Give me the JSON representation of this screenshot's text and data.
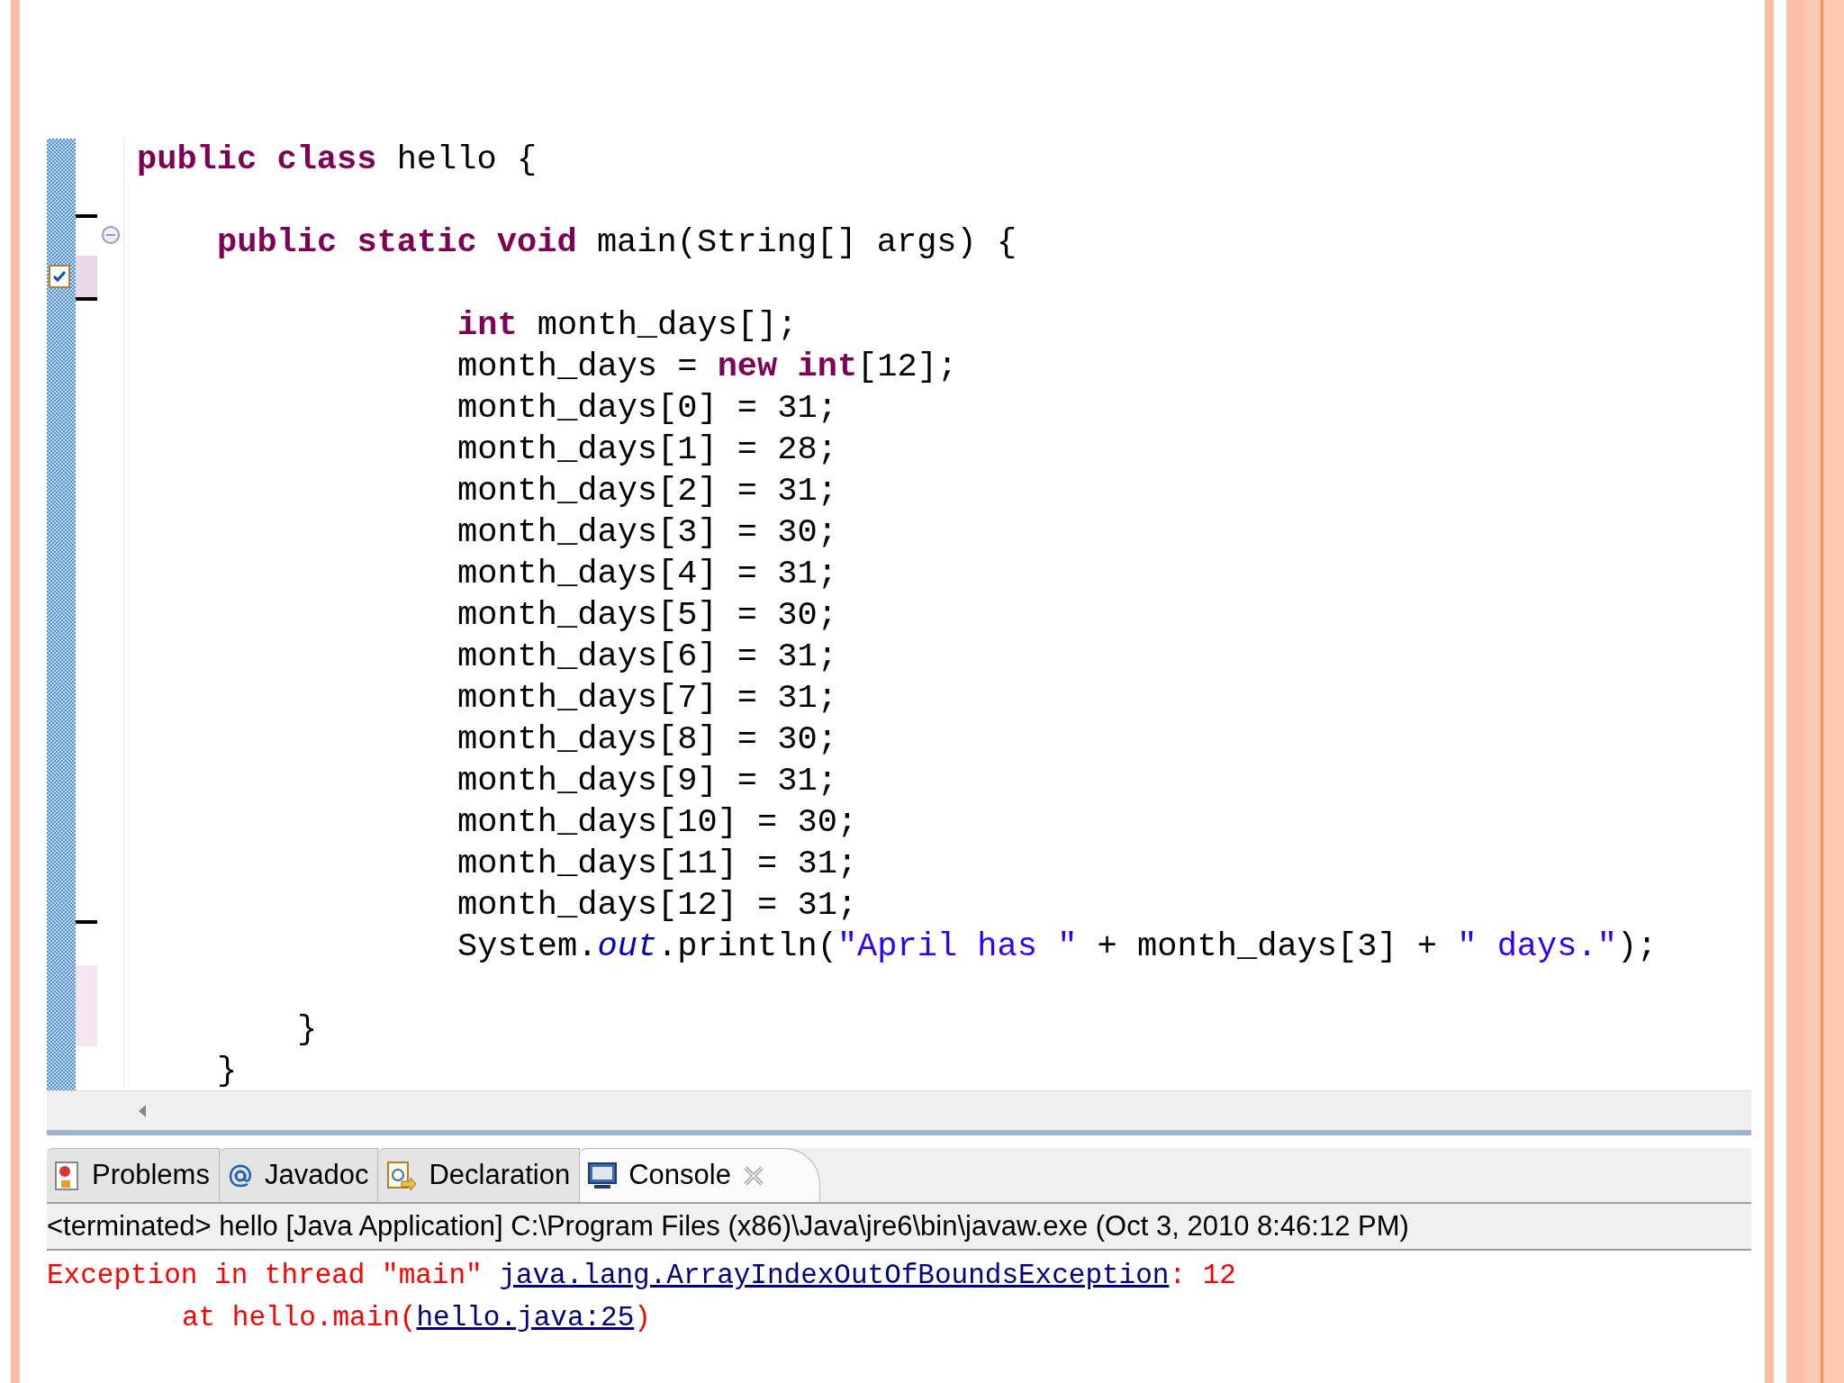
{
  "editor": {
    "lines": [
      {
        "kind": "top",
        "tokens": [
          {
            "kind": "keyword",
            "text": "public class "
          },
          {
            "kind": "plain",
            "text": "hello {"
          }
        ]
      },
      {
        "kind": "blank"
      },
      {
        "kind": "method",
        "tokens": [
          {
            "kind": "keyword",
            "text": "public static void "
          },
          {
            "kind": "plain",
            "text": "main(String[] args) {"
          }
        ]
      },
      {
        "kind": "blank"
      },
      {
        "kind": "body",
        "tokens": [
          {
            "kind": "keyword",
            "text": "int "
          },
          {
            "kind": "plain",
            "text": "month_days[];"
          }
        ]
      },
      {
        "kind": "body",
        "tokens": [
          {
            "kind": "plain",
            "text": "month_days = "
          },
          {
            "kind": "keyword",
            "text": "new int"
          },
          {
            "kind": "plain",
            "text": "[12];"
          }
        ]
      },
      {
        "kind": "body",
        "tokens": [
          {
            "kind": "plain",
            "text": "month_days[0] = 31;"
          }
        ]
      },
      {
        "kind": "body",
        "tokens": [
          {
            "kind": "plain",
            "text": "month_days[1] = 28;"
          }
        ]
      },
      {
        "kind": "body",
        "tokens": [
          {
            "kind": "plain",
            "text": "month_days[2] = 31;"
          }
        ]
      },
      {
        "kind": "body",
        "tokens": [
          {
            "kind": "plain",
            "text": "month_days[3] = 30;"
          }
        ]
      },
      {
        "kind": "body",
        "tokens": [
          {
            "kind": "plain",
            "text": "month_days[4] = 31;"
          }
        ]
      },
      {
        "kind": "body",
        "tokens": [
          {
            "kind": "plain",
            "text": "month_days[5] = 30;"
          }
        ]
      },
      {
        "kind": "body",
        "tokens": [
          {
            "kind": "plain",
            "text": "month_days[6] = 31;"
          }
        ]
      },
      {
        "kind": "body",
        "tokens": [
          {
            "kind": "plain",
            "text": "month_days[7] = 31;"
          }
        ]
      },
      {
        "kind": "body",
        "tokens": [
          {
            "kind": "plain",
            "text": "month_days[8] = 30;"
          }
        ]
      },
      {
        "kind": "body",
        "tokens": [
          {
            "kind": "plain",
            "text": "month_days[9] = 31;"
          }
        ]
      },
      {
        "kind": "body",
        "tokens": [
          {
            "kind": "plain",
            "text": "month_days[10] = 30;"
          }
        ]
      },
      {
        "kind": "body",
        "tokens": [
          {
            "kind": "plain",
            "text": "month_days[11] = 31;"
          }
        ]
      },
      {
        "kind": "body",
        "tokens": [
          {
            "kind": "plain",
            "text": "month_days[12] = 31;"
          }
        ]
      },
      {
        "kind": "body",
        "tokens": [
          {
            "kind": "plain",
            "text": "System."
          },
          {
            "kind": "field",
            "text": "out"
          },
          {
            "kind": "plain",
            "text": ".println("
          },
          {
            "kind": "string",
            "text": "\"April has \""
          },
          {
            "kind": "plain",
            "text": " + month_days[3] + "
          },
          {
            "kind": "string",
            "text": "\" days.\""
          },
          {
            "kind": "plain",
            "text": ");"
          }
        ]
      },
      {
        "kind": "blank"
      },
      {
        "kind": "method_end",
        "tokens": [
          {
            "kind": "plain",
            "text": "}"
          }
        ]
      },
      {
        "kind": "class_end",
        "tokens": [
          {
            "kind": "plain",
            "text": "}"
          }
        ]
      }
    ]
  },
  "tabs": [
    {
      "label": "Problems",
      "selected": false
    },
    {
      "label": "Javadoc",
      "selected": false
    },
    {
      "label": "Declaration",
      "selected": false
    },
    {
      "label": "Console",
      "selected": true
    }
  ],
  "console": {
    "header": "<terminated> hello [Java Application] C:\\Program Files (x86)\\Java\\jre6\\bin\\javaw.exe (Oct 3, 2010 8:46:12 PM)",
    "lines": [
      [
        {
          "kind": "error",
          "text": "Exception in thread \"main\" "
        },
        {
          "kind": "link",
          "text": "java.lang.ArrayIndexOutOfBoundsException"
        },
        {
          "kind": "error",
          "text": ": 12"
        }
      ],
      [
        {
          "kind": "error",
          "text": "at hello.main("
        },
        {
          "kind": "link",
          "text": "hello.java:25"
        },
        {
          "kind": "error",
          "text": ")"
        }
      ]
    ]
  }
}
